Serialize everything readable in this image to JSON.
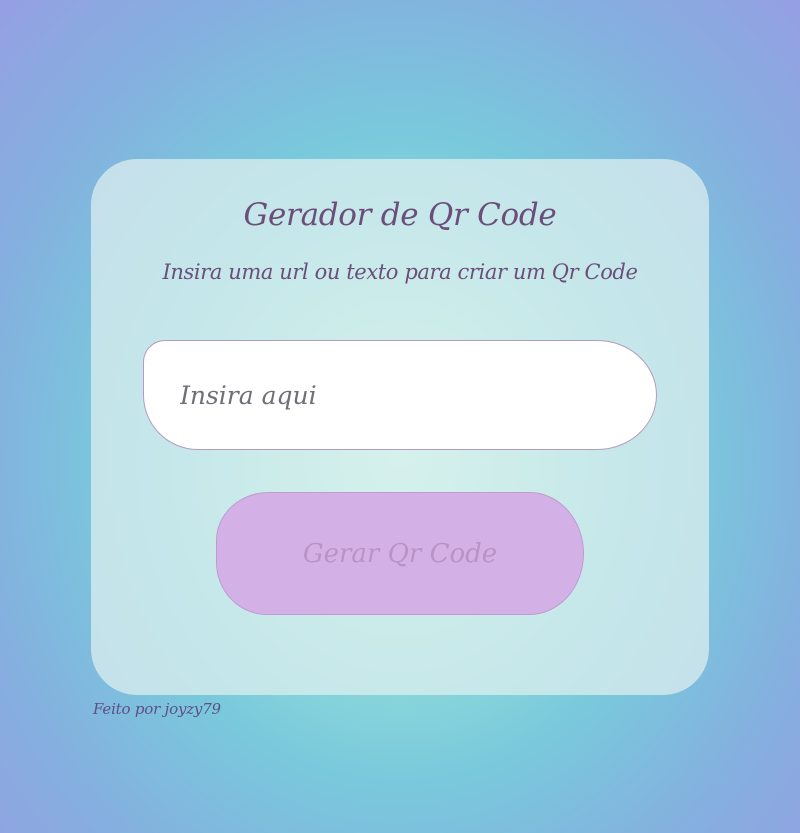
{
  "card": {
    "title": "Gerador de Qr Code",
    "subtitle": "Insira uma url ou texto para criar um Qr Code"
  },
  "input": {
    "placeholder": "Insira aqui",
    "value": ""
  },
  "button": {
    "label": "Gerar Qr Code"
  },
  "footer": {
    "credit": "Feito por joyzy79"
  },
  "colors": {
    "text": "#6b4f7a",
    "button_bg": "#d3b0e6",
    "button_text": "#b894c6",
    "input_border": "#b39cc2"
  }
}
